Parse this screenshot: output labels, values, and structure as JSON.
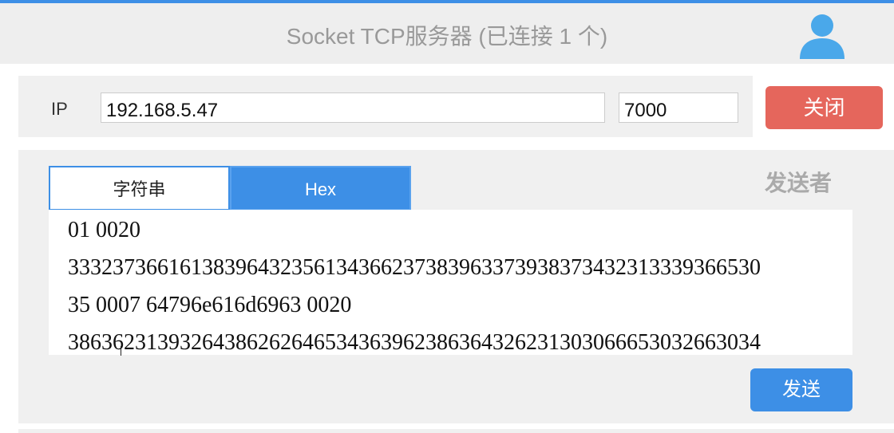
{
  "header": {
    "title": "Socket TCP服务器 (已连接 1 个)",
    "avatar_icon": "user-avatar-icon"
  },
  "connection": {
    "ip_label": "IP",
    "ip_value": "192.168.5.47",
    "port_value": "7000",
    "close_label": "关闭"
  },
  "send_panel": {
    "tabs": [
      {
        "label": "字符串",
        "active": false
      },
      {
        "label": "Hex",
        "active": true
      }
    ],
    "sender_label": "发送者",
    "lines": [
      "01 0020",
      "3332373661613839643235613436623738396337393837343231333936653 0",
      "35 0007 64796e616d6963 0020",
      "38636231393264386262646534363962386364326231303066653032663034"
    ],
    "send_label": "发送"
  },
  "colors": {
    "accent": "#3d8fe6",
    "danger": "#e5665c"
  }
}
